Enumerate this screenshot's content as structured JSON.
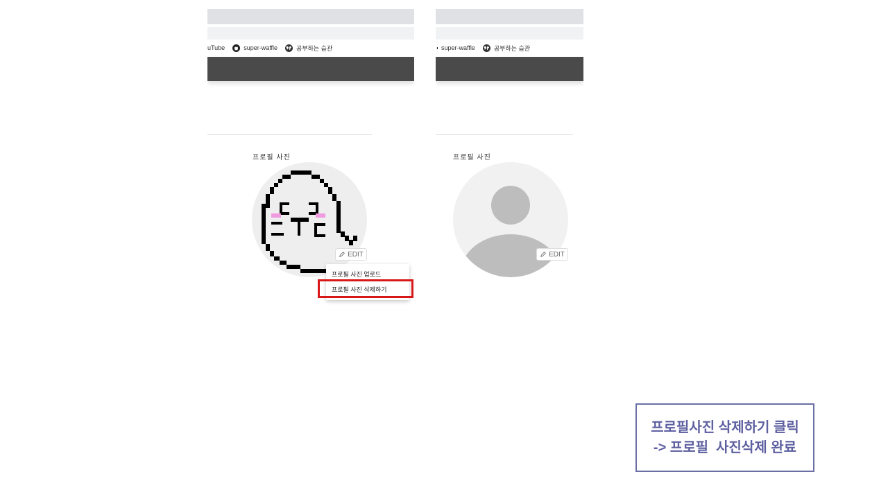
{
  "left_panel": {
    "links": [
      {
        "label": "uTube",
        "icon": "youtube-icon"
      },
      {
        "label": "super-waffle",
        "icon": "github-icon"
      },
      {
        "label": "공부하는 습관",
        "icon": "globe-icon"
      }
    ],
    "profile_label": "프로필 사진",
    "edit_label": "EDIT",
    "menu_items": [
      "프로필 사진 업로드",
      "프로필 사진 삭제하기"
    ]
  },
  "right_panel": {
    "links": [
      {
        "label": "super-waffle",
        "icon": "github-icon"
      },
      {
        "label": "공부하는 습관",
        "icon": "globe-icon"
      }
    ],
    "profile_label": "프로필 사진",
    "edit_label": "EDIT"
  },
  "callout": {
    "line1": "프로필사진 삭제하기 클릭",
    "line2": "-> 프로필  사진삭제 완료"
  },
  "colors": {
    "highlight": "#d81818",
    "callout_border": "#6b6fa6",
    "callout_text": "#5d5fa0",
    "avatar_bg": "#eeeeee",
    "default_avatar": "#bdbdbd",
    "blush": "#f09adf"
  }
}
